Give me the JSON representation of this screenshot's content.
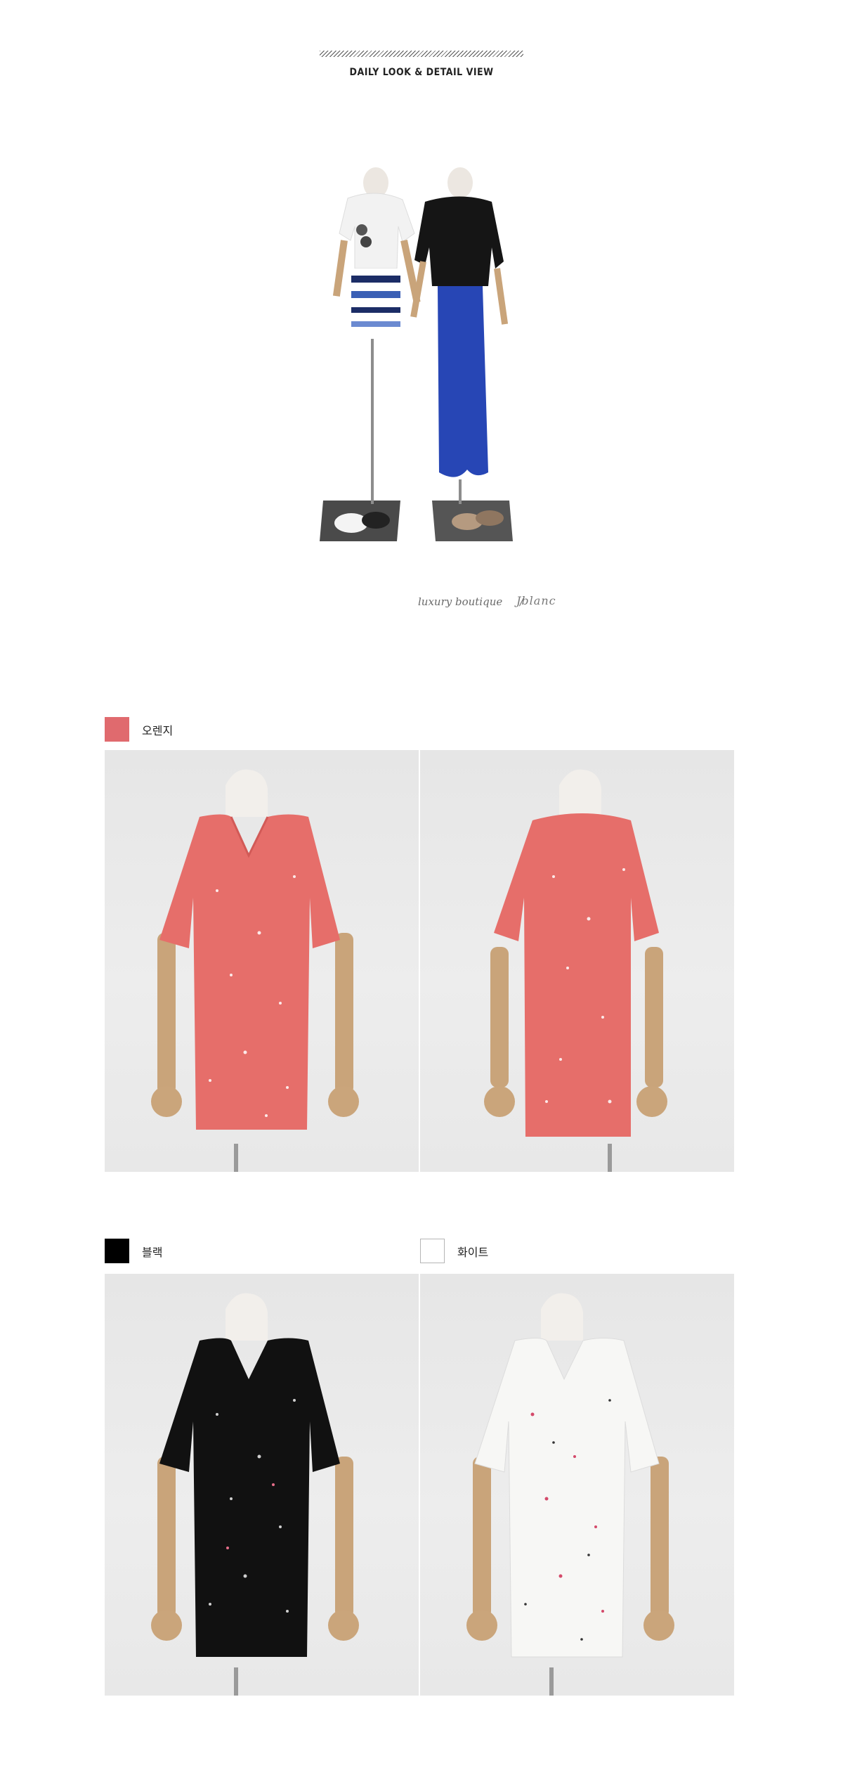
{
  "header": {
    "title": "DAILY LOOK & DETAIL VIEW"
  },
  "boutique": {
    "text": "luxury boutique",
    "separator": "/",
    "signature": "Jblanc"
  },
  "colors": [
    {
      "name": "오렌지",
      "swatch": "#e06a6e"
    },
    {
      "name": "블랙",
      "swatch": "#000000"
    },
    {
      "name": "화이트",
      "swatch": "#ffffff"
    }
  ],
  "palette": {
    "coral_shirt": "#e66e6a",
    "black_shirt": "#111111",
    "white_shirt": "#f7f7f5",
    "mannequin_neck": "#f1eeea",
    "wood_arm": "#c9a47a",
    "blue_skirt": "#2746b5"
  }
}
